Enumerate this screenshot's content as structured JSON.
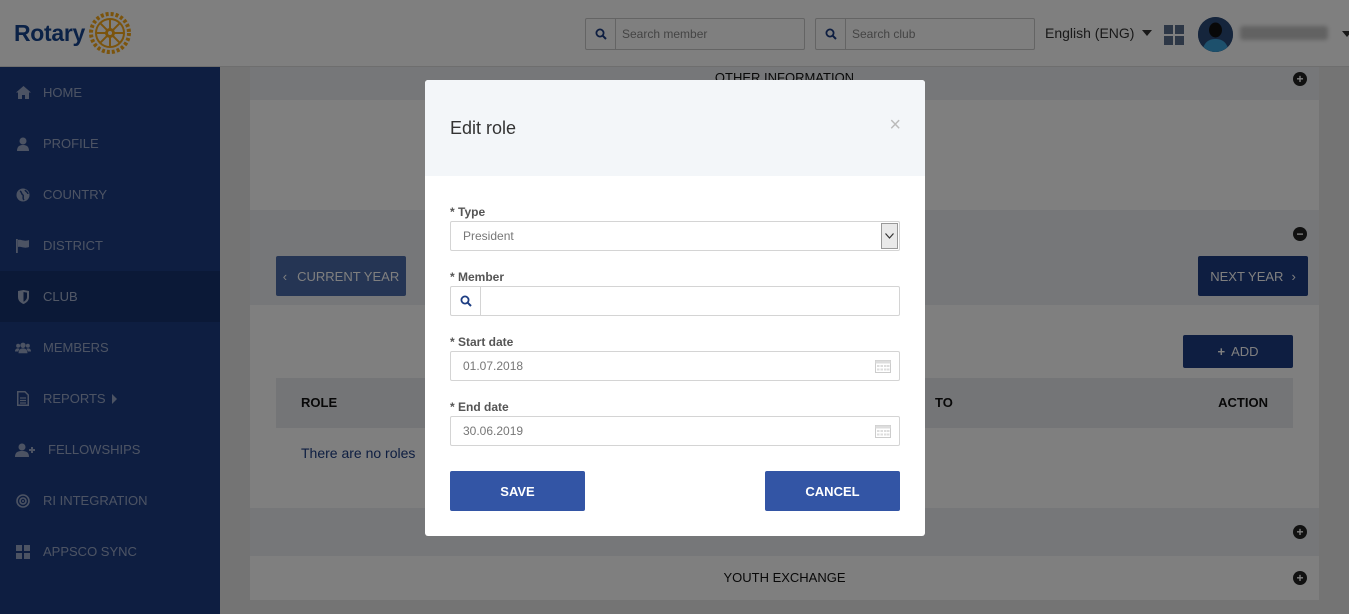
{
  "header": {
    "logo_text": "Rotary",
    "search_member_placeholder": "Search member",
    "search_club_placeholder": "Search club",
    "language": "English (ENG)"
  },
  "sidebar": {
    "items": [
      {
        "label": "HOME",
        "icon": "home-icon"
      },
      {
        "label": "PROFILE",
        "icon": "user-icon"
      },
      {
        "label": "COUNTRY",
        "icon": "globe-icon"
      },
      {
        "label": "DISTRICT",
        "icon": "flag-icon"
      },
      {
        "label": "CLUB",
        "icon": "shield-icon",
        "active": true
      },
      {
        "label": "MEMBERS",
        "icon": "users-icon"
      },
      {
        "label": "REPORTS",
        "icon": "document-icon"
      },
      {
        "label": "FELLOWSHIPS",
        "icon": "user-plus-icon"
      },
      {
        "label": "RI INTEGRATION",
        "icon": "target-icon"
      },
      {
        "label": "APPSCO SYNC",
        "icon": "grid-icon"
      }
    ]
  },
  "main": {
    "other_information": "OTHER INFORMATION",
    "current_year": "CURRENT YEAR",
    "next_year": "NEXT YEAR",
    "add": "ADD",
    "table_headers": {
      "role": "ROLE",
      "to": "TO",
      "action": "ACTION"
    },
    "empty_text": "There are no roles",
    "youth_exchange": "YOUTH EXCHANGE"
  },
  "modal": {
    "title": "Edit role",
    "close": "×",
    "type_label": "* Type",
    "type_value": "President",
    "member_label": "* Member",
    "member_value": "",
    "start_label": "* Start date",
    "start_value": "01.07.2018",
    "end_label": "* End date",
    "end_value": "30.06.2019",
    "save": "SAVE",
    "cancel": "CANCEL"
  },
  "colors": {
    "brand_blue": "#1d3d83",
    "button_blue": "#3355a5",
    "rotary_gold": "#f7a81b"
  }
}
